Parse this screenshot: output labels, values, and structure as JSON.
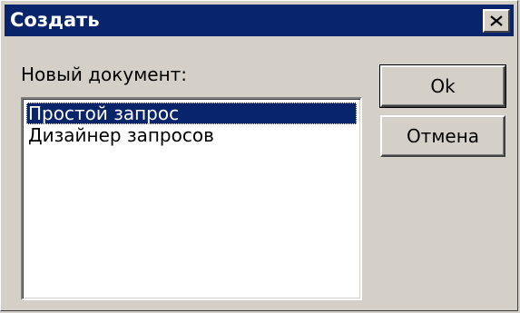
{
  "window": {
    "title": "Создать"
  },
  "close_icon": "close-icon",
  "doc_label": "Новый документ:",
  "list": {
    "items": [
      {
        "label": "Простой запрос",
        "selected": true
      },
      {
        "label": "Дизайнер запросов",
        "selected": false
      }
    ]
  },
  "buttons": {
    "ok_label": "Ok",
    "cancel_label": "Отмена"
  },
  "colors": {
    "titlebar": "#08246b",
    "window_bg": "#d4d0c8",
    "selection": "#08246b"
  }
}
